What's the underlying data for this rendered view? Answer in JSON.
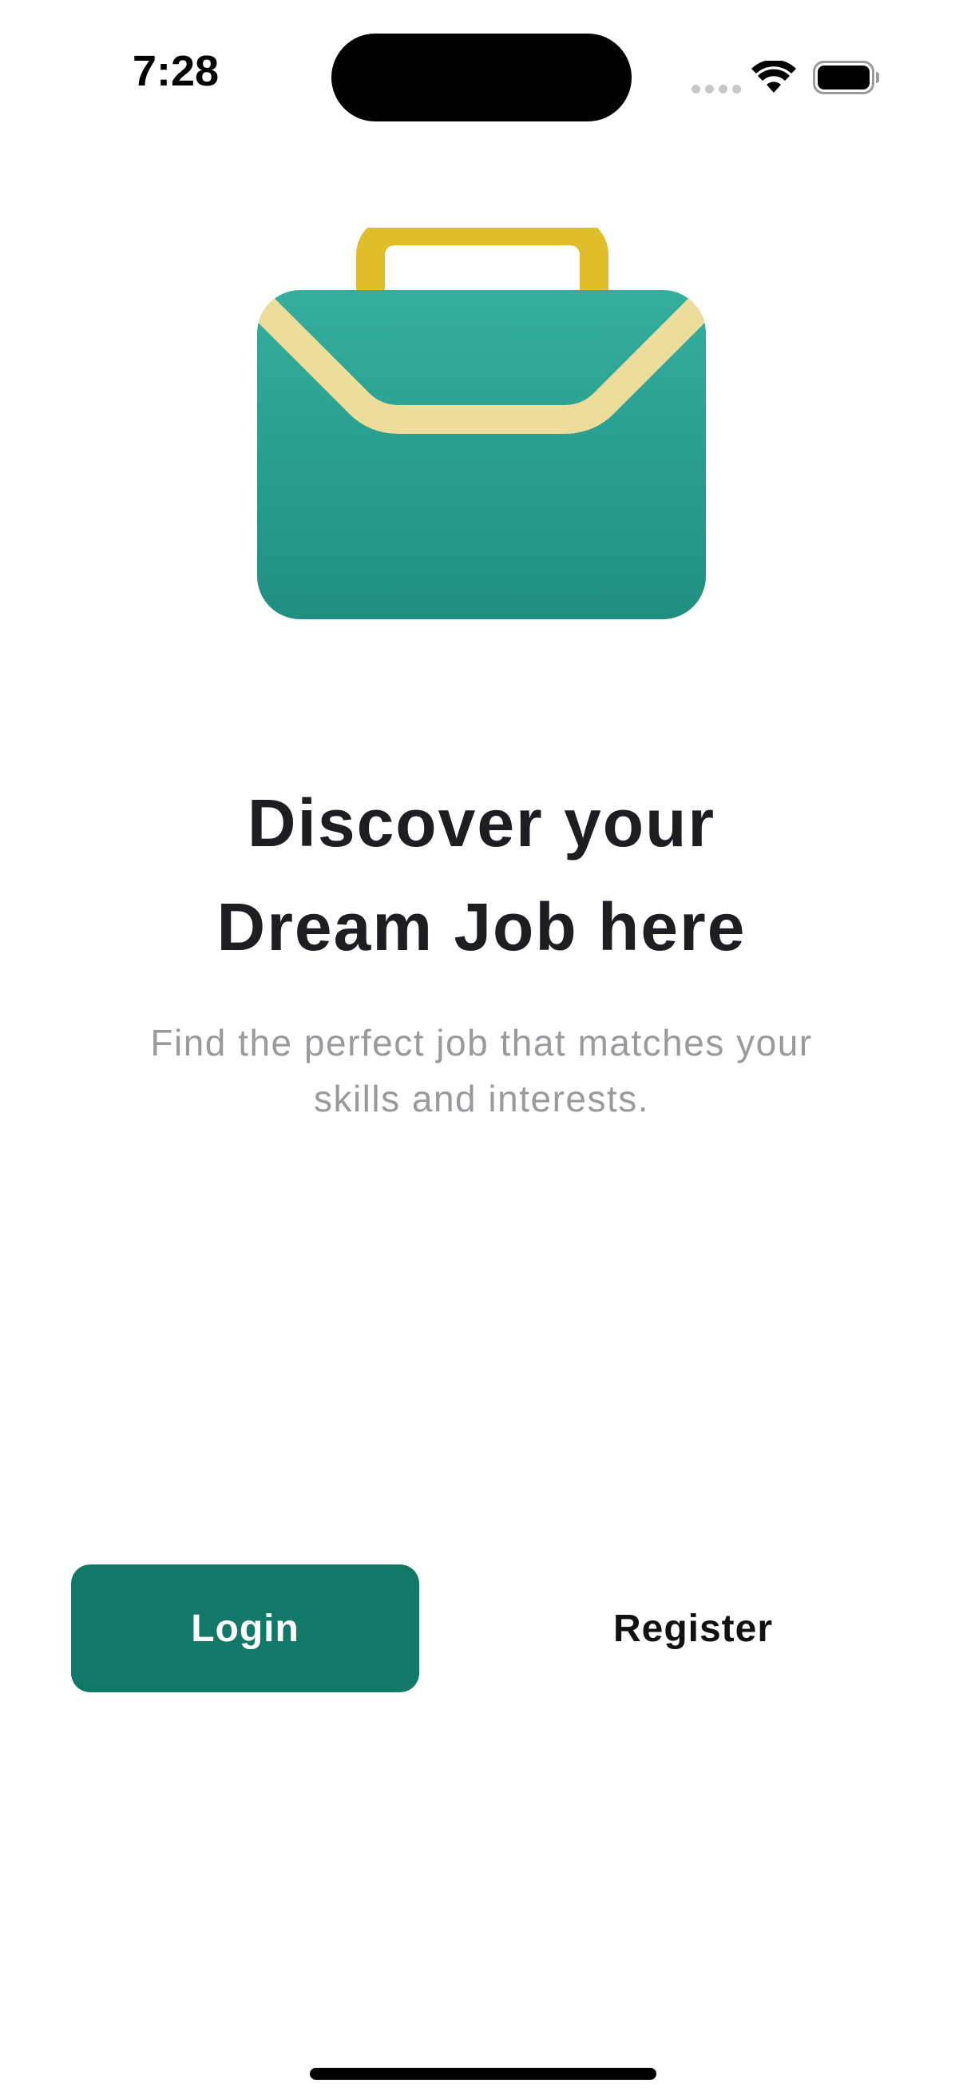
{
  "status_bar": {
    "time": "7:28",
    "icons": [
      "signal-dots-icon",
      "wifi-icon",
      "battery-icon"
    ]
  },
  "illustration": {
    "icon": "briefcase-icon",
    "colors": {
      "body_top": "#35AE9D",
      "body_bottom": "#208F81",
      "handle": "#DFBD2B",
      "flap": "#ECDD9A"
    }
  },
  "headline": {
    "line1": "Discover your",
    "line2": "Dream Job here"
  },
  "subtitle": {
    "line1": "Find the perfect job that matches your",
    "line2": "skills and interests."
  },
  "actions": {
    "login_label": "Login",
    "register_label": "Register"
  },
  "colors": {
    "accent": "#127968",
    "headline_text": "#1D1D22",
    "subtitle_text": "#9A9A9E",
    "background": "#FFFFFF"
  }
}
